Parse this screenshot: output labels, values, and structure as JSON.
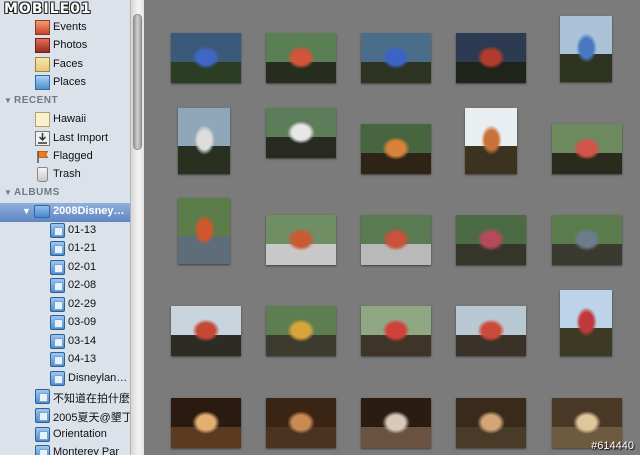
{
  "logo": {
    "text": "MOBILE01"
  },
  "watermark": {
    "text": "#614440"
  },
  "library": {
    "items": [
      {
        "label": "Events",
        "icon": "events-icon"
      },
      {
        "label": "Photos",
        "icon": "photos-icon"
      },
      {
        "label": "Faces",
        "icon": "faces-icon"
      },
      {
        "label": "Places",
        "icon": "places-icon"
      }
    ]
  },
  "recent": {
    "header": "RECENT",
    "items": [
      {
        "label": "Hawaii",
        "icon": "hawaii-album-icon"
      },
      {
        "label": "Last Import",
        "icon": "last-import-icon"
      },
      {
        "label": "Flagged",
        "icon": "flag-icon"
      },
      {
        "label": "Trash",
        "icon": "trash-icon"
      }
    ]
  },
  "albums": {
    "header": "ALBUMS",
    "folder": {
      "label": "2008Disney…",
      "icon": "folder-icon",
      "selected": true
    },
    "children": [
      "01-13",
      "01-21",
      "02-01",
      "02-08",
      "02-29",
      "03-09",
      "03-14",
      "04-13",
      "Disneylan…"
    ],
    "others": [
      "不知道在拍什麼",
      "2005夏天@墾丁",
      "Orientation",
      "Monterey Par"
    ]
  },
  "photos": {
    "count": 25,
    "columns": 5
  },
  "colors": {
    "sidebar_bg": "#dbe2ea",
    "grid_bg": "#7b7b7b",
    "selection": "#6d90c8"
  }
}
